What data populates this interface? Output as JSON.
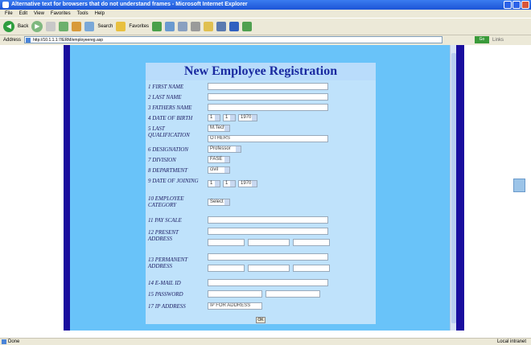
{
  "window": {
    "title": "Alternative text for browsers that do not understand frames - Microsoft Internet Explorer"
  },
  "menu": [
    "File",
    "Edit",
    "View",
    "Favorites",
    "Tools",
    "Help"
  ],
  "toolbar": {
    "back_label": "Back",
    "search_label": "Search",
    "favorites_label": "Favorites"
  },
  "address": {
    "label": "Address",
    "url": "http://10.1.1.1:7/ERM/employeereg.asp",
    "go_label": "Go",
    "links_label": "Links"
  },
  "form": {
    "title": "New Employee Registration",
    "rows": [
      {
        "num": "1",
        "label": "FIRST NAME"
      },
      {
        "num": "2",
        "label": "LAST NAME"
      },
      {
        "num": "3",
        "label": "FATHERS NAME"
      },
      {
        "num": "4",
        "label": "DATE OF BIRTH"
      },
      {
        "num": "5",
        "label": "LAST QUALIFICATION"
      },
      {
        "num": "6",
        "label": "DESIGNATION"
      },
      {
        "num": "7",
        "label": "DIVISION"
      },
      {
        "num": "8",
        "label": "DEPARTMENT"
      },
      {
        "num": "9",
        "label": "DATE OF JOINING"
      },
      {
        "num": "10",
        "label": "EMPLOYEE CATEGORY"
      },
      {
        "num": "11",
        "label": "PAY SCALE"
      },
      {
        "num": "12",
        "label": "PRESENT ADDRESS"
      },
      {
        "num": "13",
        "label": "PERMANENT ADDRESS"
      },
      {
        "num": "14",
        "label": "E-MAIL ID"
      },
      {
        "num": "15",
        "label": "PASSWORD"
      },
      {
        "num": "17",
        "label": "IP ADDRESS"
      }
    ],
    "dob": {
      "day": "1",
      "month": "1",
      "year": "1970"
    },
    "qualification": {
      "select": "M.Tech",
      "other": "OTHERS"
    },
    "designation": "Professor",
    "division": "FASE",
    "department": "civil",
    "doj": {
      "day": "1",
      "month": "1",
      "year": "1970"
    },
    "category": "Select",
    "ip_address": "IP FOR ADDRESS",
    "submit_label": "OK"
  },
  "status": {
    "left": "Done",
    "right": "Local intranet"
  }
}
